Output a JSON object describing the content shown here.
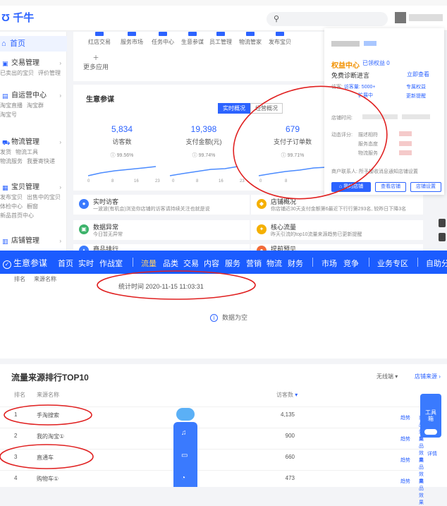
{
  "header": {
    "logo_text": "千牛",
    "search_placeholder": ""
  },
  "sidebar": {
    "home": "首页",
    "sections": [
      {
        "title": "交易管理",
        "links": [
          "已卖出的宝贝",
          "评价管理"
        ]
      },
      {
        "title": "自运营中心",
        "links": [
          "淘宝直播",
          "淘宝群",
          "淘宝号"
        ]
      },
      {
        "title": "物流管理",
        "links": [
          "发货",
          "物流工具",
          "物流服务",
          "我要寄快递"
        ]
      },
      {
        "title": "宝贝管理",
        "links": [
          "发布宝贝",
          "出售中的宝贝",
          "体检中心",
          "橱窗",
          "新品首页中心"
        ]
      },
      {
        "title": "店铺管理"
      }
    ]
  },
  "tools": {
    "items": [
      "红店交易",
      "服务市场",
      "任务中心",
      "生意参谋",
      "员工管理",
      "物流管家",
      "发布宝贝"
    ],
    "more": "更多应用"
  },
  "biz": {
    "title": "生意参谋",
    "tab_realtime": "实时概况",
    "tab_ops": "经营概况",
    "metrics": [
      {
        "value": "5,834",
        "label": "访客数",
        "pct": "99.56%"
      },
      {
        "value": "19,398",
        "label": "支付金额(元)",
        "pct": "99.74%"
      },
      {
        "value": "679",
        "label": "支付子订单数",
        "pct": "99.71%"
      }
    ],
    "axis_ticks": [
      "0",
      "8",
      "16",
      "23"
    ]
  },
  "tiles": [
    {
      "title": "实时访客",
      "sub": "一波波(有机会)浏览你店铺的访客请持续关注也就是说"
    },
    {
      "title": "店铺概况",
      "sub": "你店铺近30天支付金额第6最近下行行第293名, 较昨日下降3名"
    },
    {
      "title": "数据异常",
      "sub": "今日暂无异常"
    },
    {
      "title": "核心流量",
      "sub": "昨天引流的top10流量来源趋势已更新提醒"
    },
    {
      "title": "商品排行"
    },
    {
      "title": "提前预见"
    }
  ],
  "rightpanel": {
    "quanyi": "权益中心",
    "claimed": "已领权益 0",
    "free_consult": "免费诊断进言",
    "consult_now": "立即查看",
    "fav_prefix": "访客:",
    "fav_label": "访客量: 5000+",
    "growth": "扩展中",
    "exclusive": "专属权益",
    "update_reminder": "更新提醒",
    "shop_name_label": "店铺时间:",
    "scores_label": "动态评分:",
    "scores": [
      "描述相符",
      "服务态度",
      "物流服务"
    ],
    "contact_label": "商户联系人:",
    "contact_text": "所予接收消息通知店铺设置",
    "btn_primary": "我的店铺",
    "btn_view": "查看店铺",
    "btn_settings": "店铺设置"
  },
  "nav": {
    "logo": "生意参谋",
    "items": [
      "首页",
      "实时",
      "作战室",
      "流量",
      "品类",
      "交易",
      "内容",
      "服务",
      "营销",
      "物流",
      "财务",
      "市场",
      "竞争",
      "业务专区",
      "自助分析"
    ],
    "active_index": 3
  },
  "empty_panel": {
    "col_rank": "排名",
    "col_source": "来源名称",
    "stat_time": "统计时间 2020-11-15 11:03:31",
    "empty_text": "数据为空"
  },
  "top10": {
    "title": "流量来源排行TOP10",
    "device": "无线端",
    "shop_source": "店铺来源",
    "col_rank": "排名",
    "col_source": "来源名称",
    "col_visitors": "访客数",
    "rows": [
      {
        "rank": "1",
        "name": "手淘搜索",
        "visitors": "4,135",
        "a1": "趋势",
        "a2": "商品效果"
      },
      {
        "rank": "2",
        "name": "我的淘宝①",
        "visitors": "900",
        "a1": "趋势",
        "a2": "商品效果"
      },
      {
        "rank": "3",
        "name": "直通车",
        "visitors": "660",
        "a1": "趋势",
        "a2": "商品效果"
      },
      {
        "rank": "4",
        "name": "购物车①",
        "visitors": "473",
        "a1": "趋势",
        "a2": "商品效果"
      }
    ]
  },
  "toolbox": {
    "label": "工具箱",
    "detail": "详情"
  },
  "colors": {
    "primary": "#1b5cff",
    "accent": "#f29100",
    "annotation": "#e02020"
  }
}
